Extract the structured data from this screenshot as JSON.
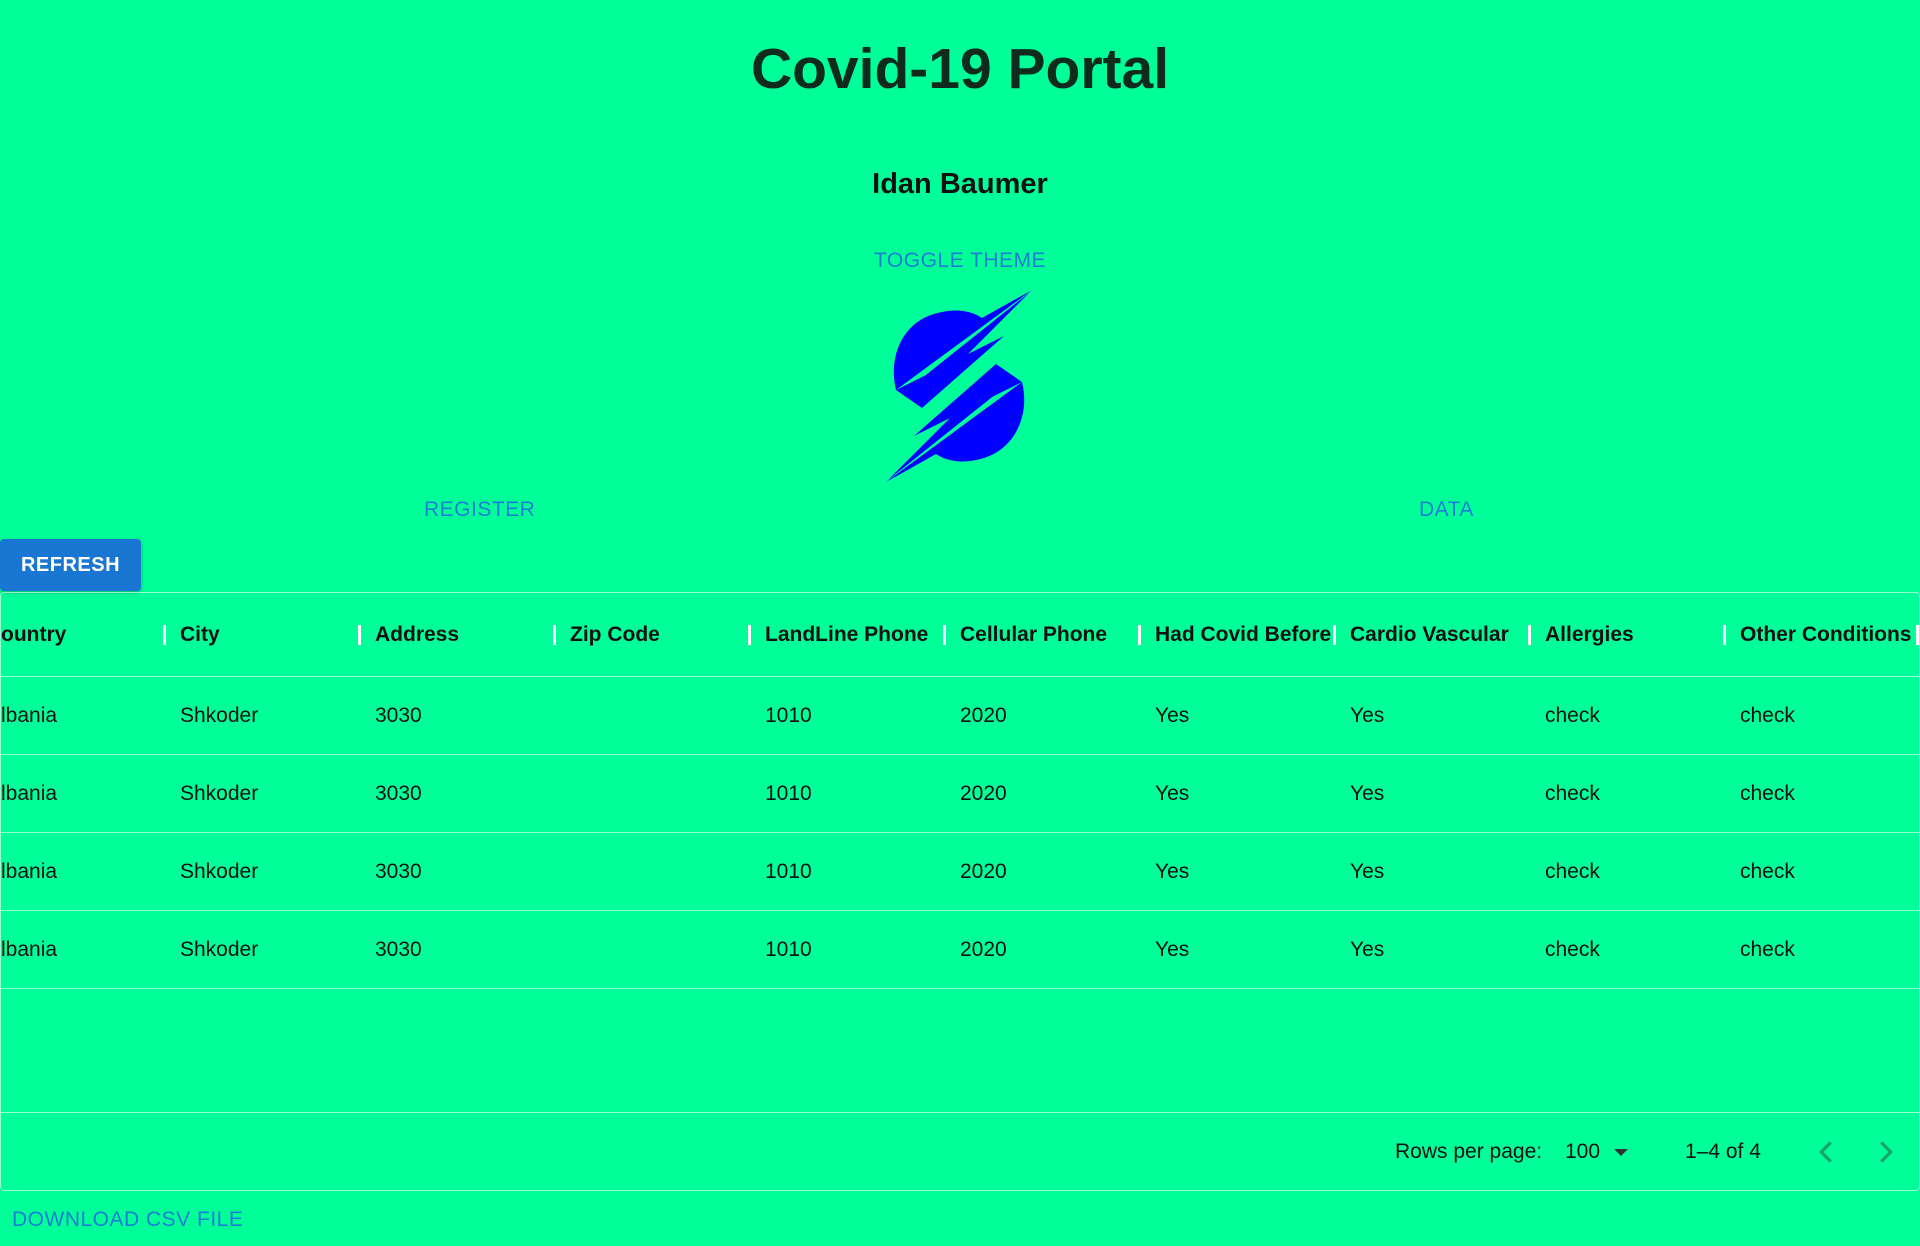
{
  "app": {
    "title": "Covid-19 Portal",
    "user_name": "Idan Baumer",
    "toggle_theme_label": "TOGGLE THEME"
  },
  "nav": {
    "register_label": "REGISTER",
    "data_label": "DATA"
  },
  "toolbar": {
    "refresh_label": "REFRESH"
  },
  "grid": {
    "columns": [
      "ountry",
      "City",
      "Address",
      "Zip Code",
      "LandLine Phone",
      "Cellular Phone",
      "Had Covid Before",
      "Cardio Vascular",
      "Allergies",
      "Other Conditions"
    ],
    "rows": [
      [
        "lbania",
        "Shkoder",
        "3030",
        "",
        "1010",
        "2020",
        "Yes",
        "Yes",
        "check",
        "check"
      ],
      [
        "lbania",
        "Shkoder",
        "3030",
        "",
        "1010",
        "2020",
        "Yes",
        "Yes",
        "check",
        "check"
      ],
      [
        "lbania",
        "Shkoder",
        "3030",
        "",
        "1010",
        "2020",
        "Yes",
        "Yes",
        "check",
        "check"
      ],
      [
        "lbania",
        "Shkoder",
        "3030",
        "",
        "1010",
        "2020",
        "Yes",
        "Yes",
        "check",
        "check"
      ]
    ]
  },
  "pagination": {
    "rows_per_page_label": "Rows per page:",
    "rows_per_page_value": "100",
    "range_label": "1–4 of 4"
  },
  "footer": {
    "download_csv_label": "DOWNLOAD CSV FILE"
  },
  "colors": {
    "background": "#00ff99",
    "accent": "#1976d2",
    "link": "#1e7bd8",
    "logo": "#0000ff"
  },
  "icons": {
    "logo": "lightning-logo-icon",
    "prev": "chevron-left-icon",
    "next": "chevron-right-icon",
    "dropdown": "caret-down-icon"
  }
}
